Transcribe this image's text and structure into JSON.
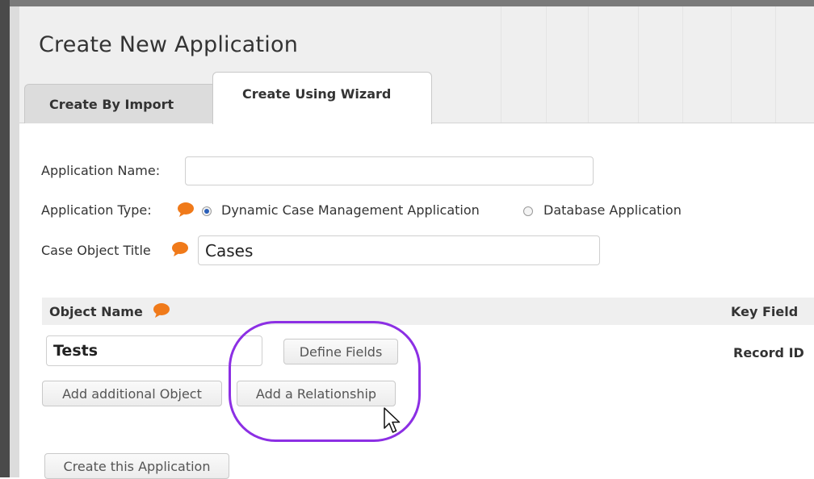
{
  "dialog": {
    "title": "Create New Application"
  },
  "tabs": [
    {
      "label": "Create By Import",
      "active": false
    },
    {
      "label": "Create Using Wizard",
      "active": true
    }
  ],
  "form": {
    "app_name_label": "Application Name:",
    "app_name_value": "",
    "app_type_label": "Application Type:",
    "app_type_options": [
      {
        "label": "Dynamic Case Management Application",
        "selected": true
      },
      {
        "label": "Database Application",
        "selected": false
      }
    ],
    "case_title_label": "Case Object Title",
    "case_title_value": "Cases"
  },
  "objects": {
    "header_name": "Object Name",
    "header_key": "Key Field",
    "row": {
      "name": "Tests",
      "key_field": "Record ID"
    },
    "define_fields_label": "Define Fields",
    "add_object_label": "Add additional Object",
    "add_relationship_label": "Add a Relationship"
  },
  "create_button_label": "Create this Application",
  "colors": {
    "help_icon": "#f07a1a",
    "highlight": "#8c2fe4",
    "radio_selected": "#2a5fb8"
  },
  "icons": [
    "help-chat-icon",
    "mouse-cursor-icon"
  ]
}
